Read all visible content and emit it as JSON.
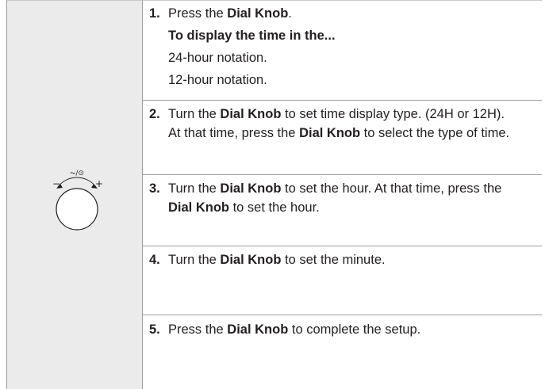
{
  "dial": {
    "mode_label": "⏦/⊙",
    "minus": "−",
    "plus": "+"
  },
  "steps": [
    {
      "num": "1.",
      "pre": "Press the ",
      "bold": "Dial Knob",
      "post": ".",
      "subheading": "To display the time in the...",
      "options": [
        "24-hour notation.",
        "12-hour notation."
      ]
    },
    {
      "num": "2.",
      "pre": "Turn the ",
      "bold": "Dial Knob",
      "mid": " to set time display type. (24H or 12H).",
      "line2_pre": "At that time, press the ",
      "line2_bold": "Dial Knob",
      "line2_post": " to select the type of time."
    },
    {
      "num": "3.",
      "pre": "Turn the ",
      "bold": "Dial Knob",
      "mid": " to set the hour. At that time, press the",
      "line2_bold": "Dial Knob",
      "line2_post": " to set the hour."
    },
    {
      "num": "4.",
      "pre": "Turn the ",
      "bold": "Dial Knob",
      "post": " to set the minute."
    },
    {
      "num": "5.",
      "pre": "Press the ",
      "bold": "Dial Knob",
      "post": " to complete the setup."
    }
  ]
}
